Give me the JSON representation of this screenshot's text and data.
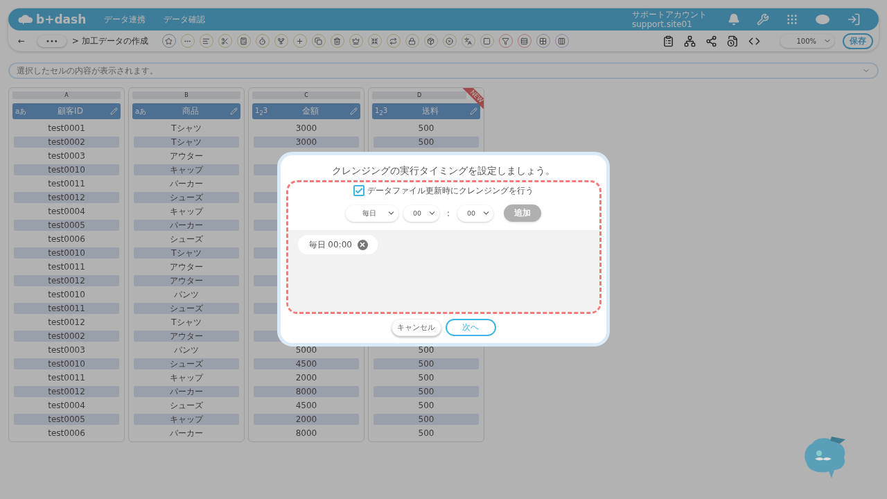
{
  "header": {
    "logo": "b+dash",
    "nav": [
      "データ連携",
      "データ確認"
    ],
    "account": {
      "name": "サポートアカウント",
      "id": "support.site01"
    }
  },
  "toolbar": {
    "back": "←",
    "breadcrumb_more": "•••",
    "breadcrumb": "> 加工データの作成",
    "zoom": "100%",
    "save": "保存"
  },
  "cell_preview": {
    "placeholder": "選択したセルの内容が表示されます。"
  },
  "columns": [
    {
      "letter": "A",
      "name": "顧客ID",
      "type_label": "aあ"
    },
    {
      "letter": "B",
      "name": "商品",
      "type_label": "aあ"
    },
    {
      "letter": "C",
      "name": "金額",
      "type_label": "1$_{2}$3"
    },
    {
      "letter": "D",
      "name": "送料",
      "type_label": "1$_{2}$3",
      "new_badge": "NEW"
    }
  ],
  "rows": [
    [
      "test0001",
      "Tシャツ",
      "3000",
      "500"
    ],
    [
      "test0002",
      "Tシャツ",
      "3000",
      "500"
    ],
    [
      "test0003",
      "アウター",
      null,
      null
    ],
    [
      "test0010",
      "キャップ",
      null,
      null
    ],
    [
      "test0011",
      "パーカー",
      null,
      null
    ],
    [
      "test0012",
      "シューズ",
      null,
      null
    ],
    [
      "test0004",
      "キャップ",
      null,
      null
    ],
    [
      "test0005",
      "パーカー",
      null,
      null
    ],
    [
      "test0006",
      "シューズ",
      null,
      null
    ],
    [
      "test0010",
      "Tシャツ",
      null,
      null
    ],
    [
      "test0011",
      "アウター",
      null,
      null
    ],
    [
      "test0012",
      "アウター",
      null,
      null
    ],
    [
      "test0010",
      "パンツ",
      null,
      null
    ],
    [
      "test0011",
      "シューズ",
      null,
      null
    ],
    [
      "test0012",
      "Tシャツ",
      null,
      null
    ],
    [
      "test0002",
      "アウター",
      null,
      null
    ],
    [
      "test0003",
      "パンツ",
      "5000",
      "500"
    ],
    [
      "test0010",
      "シューズ",
      "4500",
      "500"
    ],
    [
      "test0011",
      "キャップ",
      "2000",
      "500"
    ],
    [
      "test0012",
      "パーカー",
      "8000",
      "500"
    ],
    [
      "test0004",
      "シューズ",
      "4500",
      "500"
    ],
    [
      "test0005",
      "キャップ",
      "2000",
      "500"
    ],
    [
      "test0006",
      "パーカー",
      "8000",
      "500"
    ]
  ],
  "dialog": {
    "title": "クレンジングの実行タイミングを設定しましょう。",
    "checkbox": {
      "label": "データファイル更新時にクレンジングを行う",
      "checked": true
    },
    "frequency": "毎日",
    "hour": "00",
    "separator": ":",
    "minute": "00",
    "add_button": {
      "label": "追加",
      "disabled": true
    },
    "schedules": [
      "毎日 00:00"
    ],
    "buttons": [
      {
        "label": "キャンセル",
        "kind": "secondary"
      },
      {
        "label": "次へ",
        "kind": "primary"
      }
    ]
  }
}
